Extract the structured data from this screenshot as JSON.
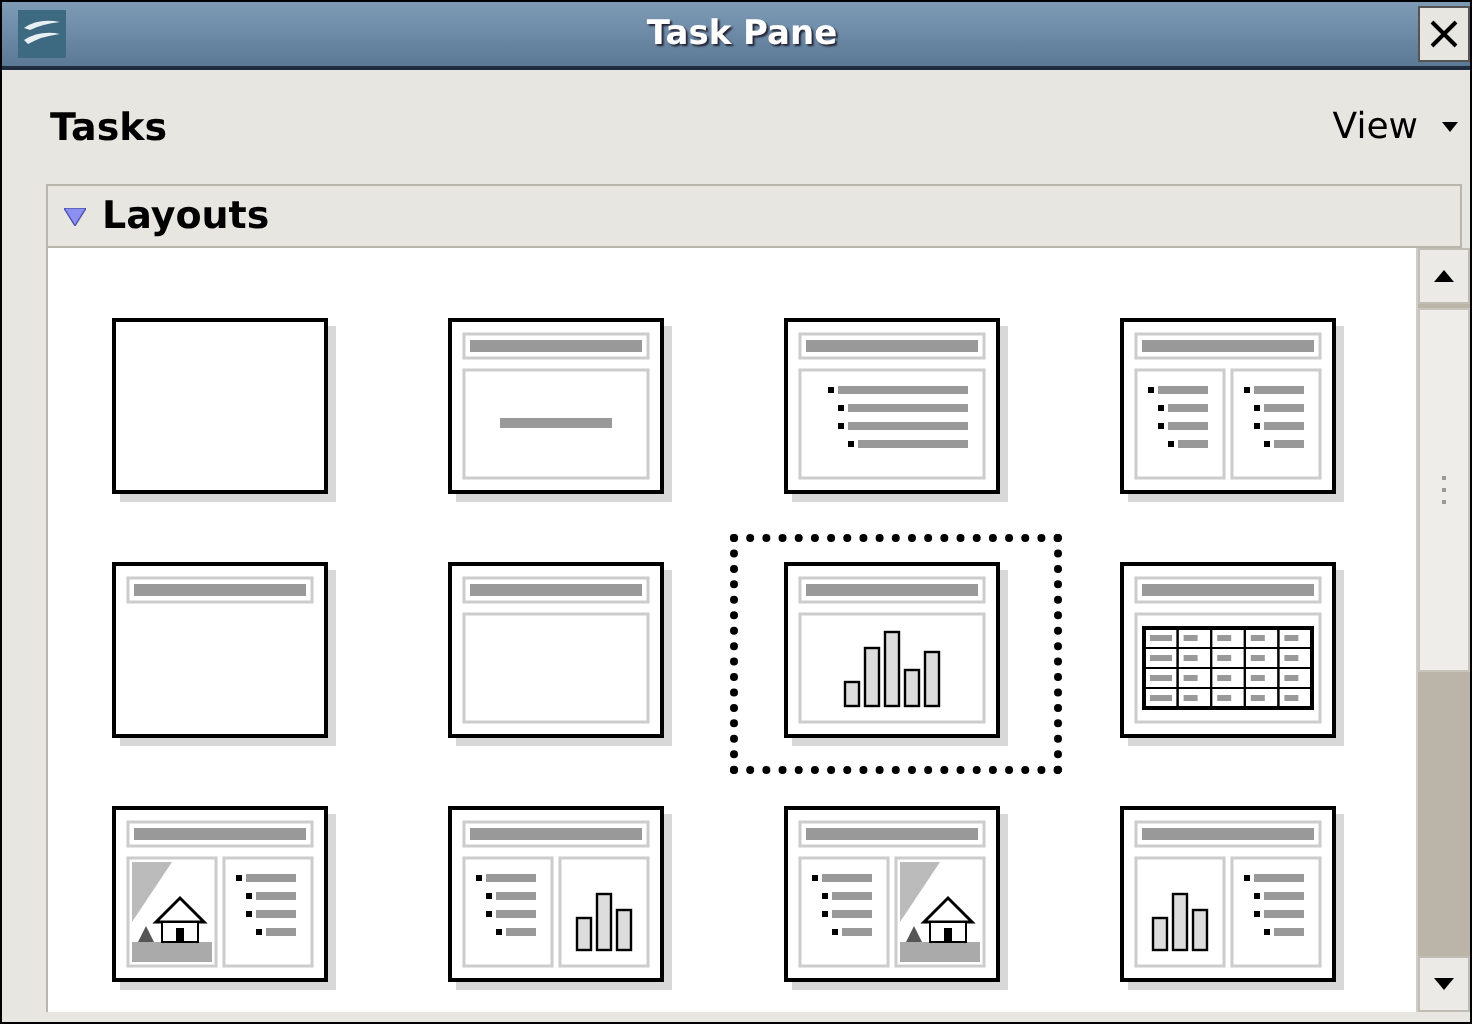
{
  "window": {
    "title": "Task Pane"
  },
  "panel": {
    "title": "Tasks",
    "view_menu": "View"
  },
  "section": {
    "title": "Layouts",
    "expanded": true
  },
  "layouts": [
    {
      "kind": "blank",
      "selected": false
    },
    {
      "kind": "title-content",
      "selected": false
    },
    {
      "kind": "title-bullets",
      "selected": false
    },
    {
      "kind": "title-two-bullets",
      "selected": false
    },
    {
      "kind": "title-only",
      "selected": false
    },
    {
      "kind": "title-box",
      "selected": false
    },
    {
      "kind": "title-chart",
      "selected": true
    },
    {
      "kind": "title-table",
      "selected": false
    },
    {
      "kind": "picture-bullets",
      "selected": false
    },
    {
      "kind": "bullets-chart",
      "selected": false
    },
    {
      "kind": "bullets-picture",
      "selected": false
    },
    {
      "kind": "chart-bullets",
      "selected": false
    }
  ]
}
